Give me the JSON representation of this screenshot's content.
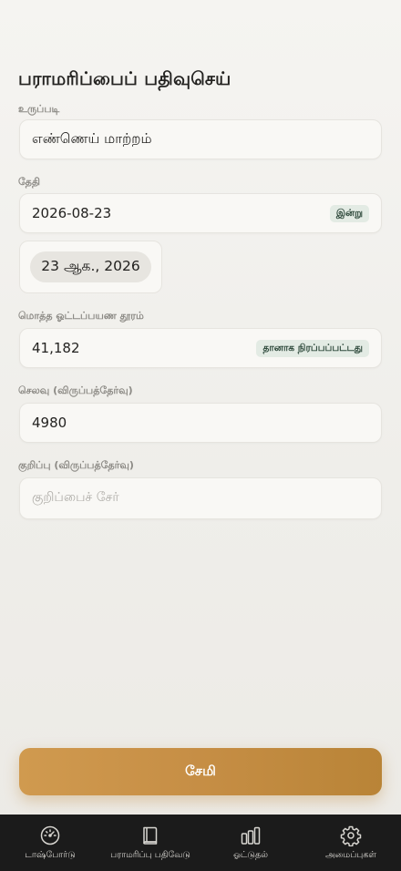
{
  "page": {
    "title": "பராமரிப்பைப் பதிவுசெய்"
  },
  "form": {
    "item": {
      "label": "உருப்படி",
      "value": "எண்ணெய் மாற்றம்"
    },
    "date": {
      "label": "தேதி",
      "value": "2026-08-23",
      "badge": "இன்று",
      "display": "23 ஆக., 2026"
    },
    "odometer": {
      "label": "மொத்த ஓட்டப்பயண தூரம்",
      "value": "41,182",
      "badge": "தானாக நிரப்பப்பட்டது"
    },
    "cost": {
      "label": "செலவு (விருப்பத்தேர்வு)",
      "value": "4980"
    },
    "note": {
      "label": "குறிப்பு (விருப்பத்தேர்வு)",
      "placeholder": "குறிப்பைச் சேர்"
    }
  },
  "actions": {
    "save_label": "சேமி"
  },
  "nav": {
    "items": [
      {
        "label": "டாஷ்போர்டு",
        "icon": "gauge-icon"
      },
      {
        "label": "பராமரிப்பு பதிவேடு",
        "icon": "book-icon"
      },
      {
        "label": "ஓட்டுதல்",
        "icon": "bar-chart-icon"
      },
      {
        "label": "அமைப்புகள்",
        "icon": "gear-icon"
      }
    ]
  },
  "colors": {
    "accent": "#c68e45",
    "badge_bg": "#e3ebe4",
    "nav_bg": "#1b1b1b"
  }
}
